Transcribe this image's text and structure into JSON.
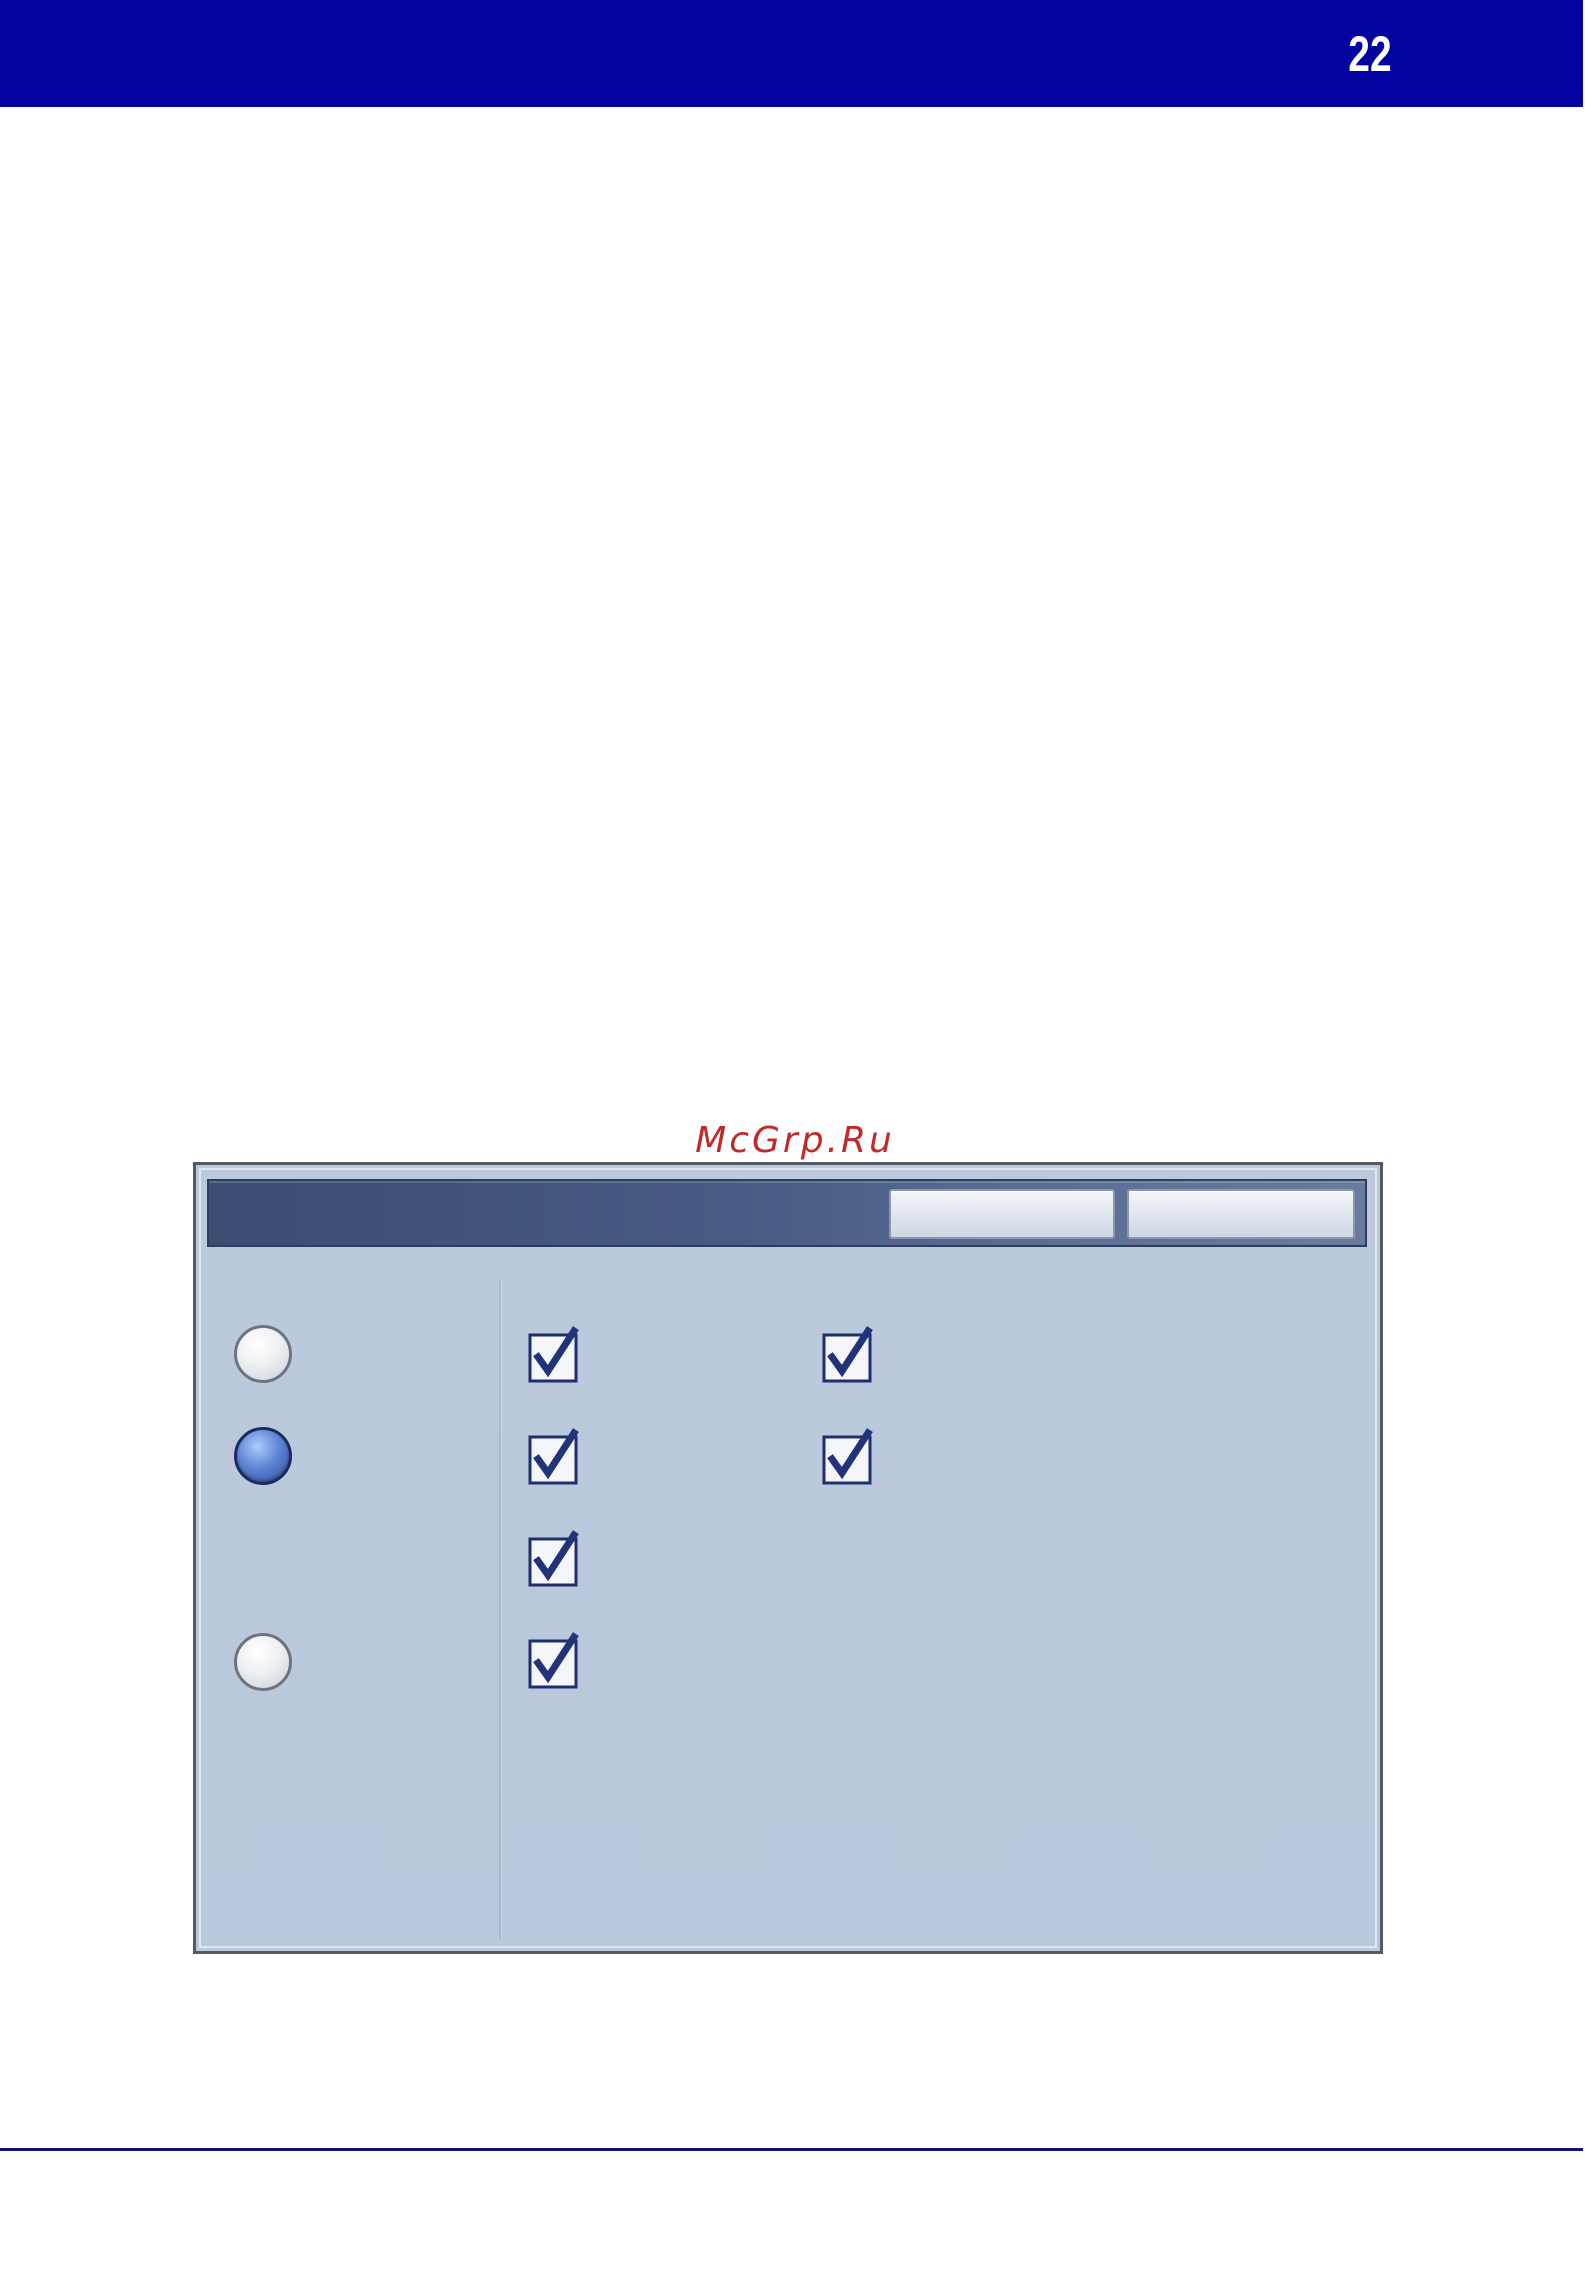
{
  "header": {
    "page_number": "22",
    "color": "#0303a0"
  },
  "watermark": {
    "text": "McGrp.Ru",
    "color": "#c02a2a"
  },
  "dialog": {
    "title_bar_color": "#475a83",
    "background_color": "#bcc9dc",
    "title_buttons": [
      "",
      ""
    ],
    "radio_options": [
      {
        "selected": false
      },
      {
        "selected": true
      },
      {
        "selected": false
      }
    ],
    "checkboxes_column_1": [
      {
        "checked": true
      },
      {
        "checked": true
      },
      {
        "checked": true
      },
      {
        "checked": true
      }
    ],
    "checkboxes_column_2": [
      {
        "checked": true
      },
      {
        "checked": true
      }
    ],
    "checkbox_icon": "checkmark-icon",
    "radio_selected_color": "#5f86d6"
  }
}
